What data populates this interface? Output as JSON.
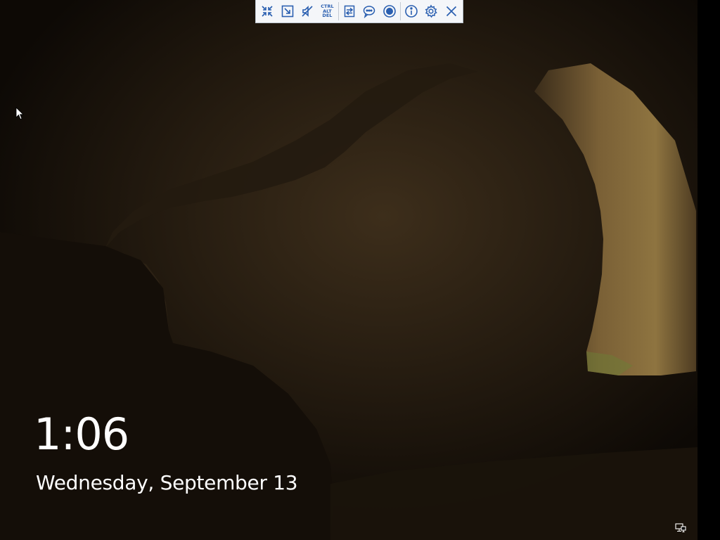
{
  "lock_screen": {
    "time": "1:06",
    "date": "Wednesday, September 13"
  },
  "toolbar": {
    "items": [
      {
        "icon": "fit-screen-icon"
      },
      {
        "icon": "fullscreen-icon"
      },
      {
        "icon": "mute-icon"
      },
      {
        "icon": "ctrl-alt-del-icon",
        "label_lines": [
          "CTRL",
          "ALT",
          "DEL"
        ]
      },
      {
        "icon": "switch-monitor-icon"
      },
      {
        "icon": "chat-icon"
      },
      {
        "icon": "record-icon"
      },
      {
        "icon": "info-icon"
      },
      {
        "icon": "settings-gear-icon"
      },
      {
        "icon": "close-icon"
      }
    ],
    "accent_color": "#2a5fb0"
  },
  "tray": {
    "network_icon": "network-monitor-icon"
  }
}
